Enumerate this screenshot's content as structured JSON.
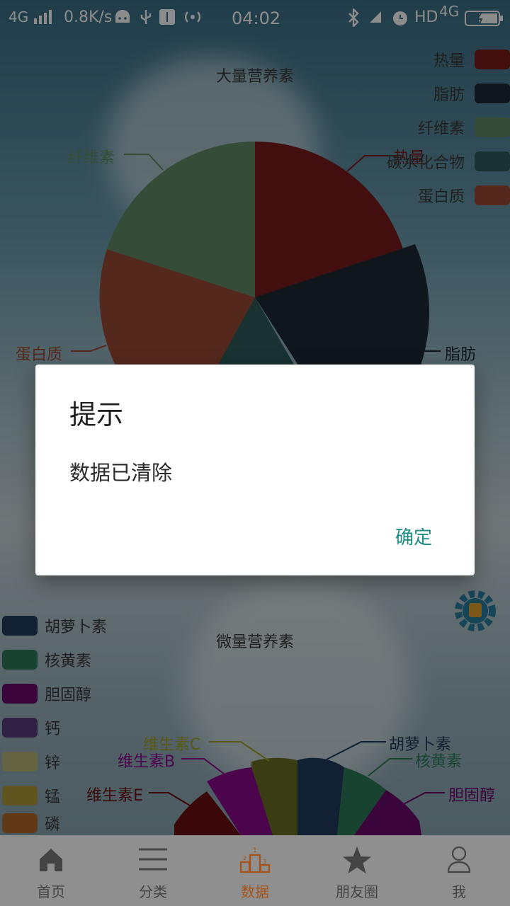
{
  "status_bar": {
    "network": "4G",
    "speed": "0.8K/s",
    "time": "04:02",
    "hd": "HD",
    "network2": "4G"
  },
  "macro_chart": {
    "title": "大量营养素",
    "legend": [
      {
        "label": "热量",
        "color": "#7a1a1a"
      },
      {
        "label": "脂肪",
        "color": "#1d2a36"
      },
      {
        "label": "纤维素",
        "color": "#5f8a66"
      },
      {
        "label": "碳水化合物",
        "color": "#2f5a5a"
      },
      {
        "label": "蛋白质",
        "color": "#9a4a35"
      }
    ],
    "callouts": {
      "heat": "热量",
      "fat": "脂肪",
      "fiber": "纤维素",
      "protein": "蛋白质"
    }
  },
  "micro_chart": {
    "title": "微量营养素",
    "legend": [
      {
        "label": "胡萝卜素",
        "color": "#1f3b5c"
      },
      {
        "label": "核黄素",
        "color": "#2e7a5a"
      },
      {
        "label": "胆固醇",
        "color": "#6a0a6a"
      },
      {
        "label": "钙",
        "color": "#5b3d80"
      },
      {
        "label": "锌",
        "color": "#b8b87a"
      },
      {
        "label": "锰",
        "color": "#b09a3a"
      },
      {
        "label": "磷",
        "color": "#b06a2a"
      }
    ],
    "callouts": {
      "vitc": "维生素C",
      "vitb": "维生素B",
      "vite": "维生素E",
      "carotene": "胡萝卜素",
      "riboflavin": "核黄素",
      "cholesterol": "胆固醇"
    }
  },
  "dialog": {
    "title": "提示",
    "message": "数据已清除",
    "confirm": "确定"
  },
  "tabs": [
    {
      "label": "首页",
      "icon": "home-icon"
    },
    {
      "label": "分类",
      "icon": "menu-icon"
    },
    {
      "label": "数据",
      "icon": "podium-icon"
    },
    {
      "label": "朋友圈",
      "icon": "star-icon"
    },
    {
      "label": "我",
      "icon": "user-icon"
    }
  ]
}
